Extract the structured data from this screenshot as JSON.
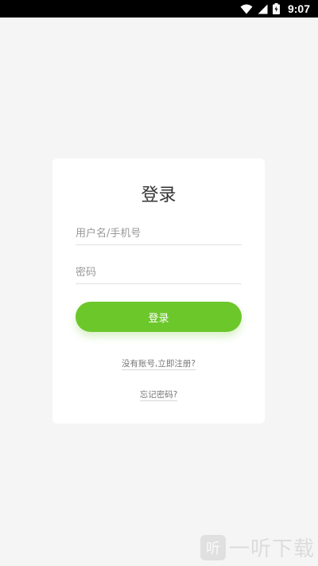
{
  "status_bar": {
    "time": "9:07",
    "icons": [
      "wifi-icon",
      "signal-icon",
      "battery-icon"
    ]
  },
  "login": {
    "title": "登录",
    "username_placeholder": "用户名/手机号",
    "username_value": "",
    "password_placeholder": "密码",
    "password_value": "",
    "login_button_label": "登录",
    "register_link": "没有账号,立即注册?",
    "forgot_link": "忘记密码?"
  },
  "watermark": {
    "logo_char": "听",
    "text": "一听下载"
  },
  "colors": {
    "accent": "#6cc72b",
    "background": "#f5f5f5",
    "card": "#ffffff"
  }
}
